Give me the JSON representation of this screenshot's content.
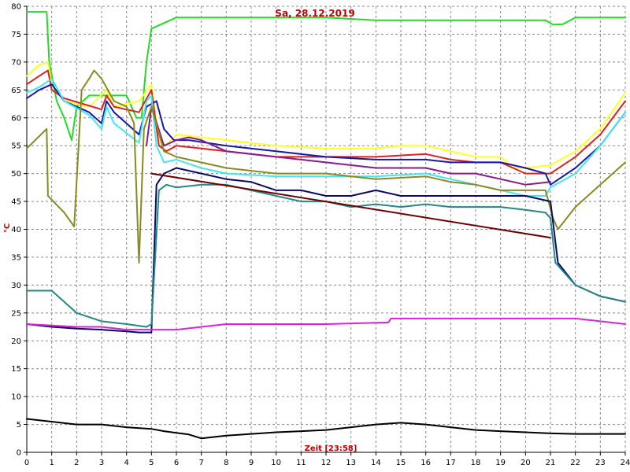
{
  "chart_data": {
    "type": "line",
    "title": "Sa, 28.12.2019",
    "xlabel": "Zeit [23:58]",
    "ylabel": "°C",
    "xlim": [
      0,
      24
    ],
    "ylim": [
      0,
      80
    ],
    "x_ticks": [
      0,
      1,
      2,
      3,
      4,
      5,
      6,
      7,
      8,
      9,
      10,
      11,
      12,
      13,
      14,
      15,
      16,
      17,
      18,
      19,
      20,
      21,
      22,
      23,
      24
    ],
    "y_ticks": [
      0,
      5,
      10,
      15,
      20,
      25,
      30,
      35,
      40,
      45,
      50,
      55,
      60,
      65,
      70,
      75,
      80
    ],
    "grid": true,
    "series": [
      {
        "color": "#22dd22",
        "points": [
          [
            0,
            79
          ],
          [
            0.8,
            79
          ],
          [
            0.9,
            70
          ],
          [
            1.2,
            63
          ],
          [
            1.5,
            60
          ],
          [
            1.8,
            56
          ],
          [
            2.0,
            62
          ],
          [
            2.5,
            64
          ],
          [
            3.0,
            64
          ],
          [
            3.5,
            64
          ],
          [
            4.0,
            64
          ],
          [
            4.4,
            60
          ],
          [
            4.6,
            60
          ],
          [
            4.8,
            70
          ],
          [
            5.0,
            76
          ],
          [
            5.5,
            77
          ],
          [
            6.0,
            78
          ],
          [
            8,
            78
          ],
          [
            10,
            78
          ],
          [
            12,
            78
          ],
          [
            14,
            77.5
          ],
          [
            16,
            77.5
          ],
          [
            18,
            77.5
          ],
          [
            20,
            77.5
          ],
          [
            20.8,
            77.5
          ],
          [
            21.1,
            76.7
          ],
          [
            21.5,
            76.8
          ],
          [
            22,
            78
          ],
          [
            24,
            78
          ]
        ]
      },
      {
        "color": "#ffff22",
        "points": [
          [
            0,
            67.5
          ],
          [
            0.5,
            69.5
          ],
          [
            0.85,
            70
          ],
          [
            1.0,
            66
          ],
          [
            1.5,
            63
          ],
          [
            2.5,
            62
          ],
          [
            3.2,
            65
          ],
          [
            3.5,
            62
          ],
          [
            4.5,
            63
          ],
          [
            5.0,
            66
          ],
          [
            5.3,
            56
          ],
          [
            5.6,
            55
          ],
          [
            6.0,
            57
          ],
          [
            8,
            56
          ],
          [
            10,
            55
          ],
          [
            12,
            54.5
          ],
          [
            14,
            54.5
          ],
          [
            15,
            55
          ],
          [
            16,
            55
          ],
          [
            17,
            54
          ],
          [
            18,
            53
          ],
          [
            19,
            53
          ],
          [
            19.5,
            51
          ],
          [
            20,
            51
          ],
          [
            21,
            51.5
          ],
          [
            22,
            54
          ],
          [
            23,
            58
          ],
          [
            24,
            64.5
          ]
        ]
      },
      {
        "color": "#dd2222",
        "points": [
          [
            0,
            66
          ],
          [
            0.5,
            67.5
          ],
          [
            0.85,
            68.5
          ],
          [
            1.0,
            65
          ],
          [
            1.5,
            63.5
          ],
          [
            3.0,
            61.5
          ],
          [
            3.2,
            64
          ],
          [
            3.5,
            62
          ],
          [
            4.5,
            61
          ],
          [
            5.0,
            65
          ],
          [
            5.3,
            55
          ],
          [
            5.6,
            54
          ],
          [
            6.0,
            55
          ],
          [
            8,
            54
          ],
          [
            10,
            53
          ],
          [
            12,
            53
          ],
          [
            14,
            53
          ],
          [
            16,
            53.5
          ],
          [
            17,
            52.5
          ],
          [
            18,
            52
          ],
          [
            19,
            52
          ],
          [
            20,
            50
          ],
          [
            21,
            50
          ],
          [
            22,
            53
          ],
          [
            23,
            57
          ],
          [
            24,
            63
          ]
        ]
      },
      {
        "color": "#1818aa",
        "points": [
          [
            0,
            63.5
          ],
          [
            0.5,
            65
          ],
          [
            1.0,
            66
          ],
          [
            1.5,
            63
          ],
          [
            2.5,
            61
          ],
          [
            3.0,
            59
          ],
          [
            3.2,
            63
          ],
          [
            3.5,
            61
          ],
          [
            4.5,
            57
          ],
          [
            4.8,
            62
          ],
          [
            5.2,
            63
          ],
          [
            5.5,
            58
          ],
          [
            5.9,
            56
          ],
          [
            6.5,
            56
          ],
          [
            8,
            55
          ],
          [
            10,
            54
          ],
          [
            12,
            53
          ],
          [
            14,
            52.5
          ],
          [
            16,
            52.5
          ],
          [
            17,
            52
          ],
          [
            18,
            52
          ],
          [
            19,
            52
          ],
          [
            20,
            51
          ],
          [
            20.8,
            50
          ],
          [
            21,
            48
          ],
          [
            22,
            51
          ],
          [
            23,
            55
          ],
          [
            24,
            61
          ]
        ]
      },
      {
        "color": "#44e6ee",
        "points": [
          [
            0,
            64.5
          ],
          [
            0.5,
            65.5
          ],
          [
            1.0,
            67
          ],
          [
            1.5,
            63
          ],
          [
            2.5,
            60.5
          ],
          [
            3.0,
            58
          ],
          [
            3.2,
            62
          ],
          [
            3.5,
            59
          ],
          [
            4.5,
            55.5
          ],
          [
            4.8,
            63
          ],
          [
            5.0,
            64
          ],
          [
            5.2,
            55
          ],
          [
            5.5,
            52
          ],
          [
            6.0,
            52.5
          ],
          [
            7,
            51
          ],
          [
            8,
            50
          ],
          [
            10,
            49.5
          ],
          [
            12,
            49.5
          ],
          [
            14,
            49.5
          ],
          [
            16,
            50
          ],
          [
            17,
            49
          ],
          [
            18,
            48
          ],
          [
            19,
            47
          ],
          [
            20,
            46
          ],
          [
            20.8,
            46
          ],
          [
            21,
            47.5
          ],
          [
            22,
            50
          ],
          [
            23,
            55
          ],
          [
            24,
            61
          ]
        ]
      },
      {
        "color": "#8a1a8a",
        "points": [
          [
            4.8,
            55
          ],
          [
            5.0,
            62
          ],
          [
            5.5,
            55
          ],
          [
            6.0,
            56
          ],
          [
            6.5,
            56.5
          ],
          [
            7,
            56
          ],
          [
            8,
            54
          ],
          [
            10,
            53
          ],
          [
            12,
            52
          ],
          [
            14,
            51
          ],
          [
            16,
            51
          ],
          [
            17,
            50
          ],
          [
            18,
            50
          ],
          [
            19,
            49
          ],
          [
            20,
            48
          ],
          [
            21,
            48.5
          ]
        ]
      },
      {
        "color": "#8a8a22",
        "points": [
          [
            0,
            54.5
          ],
          [
            0.8,
            58
          ],
          [
            0.85,
            46
          ],
          [
            1.5,
            43
          ],
          [
            1.9,
            40.5
          ],
          [
            2.2,
            65
          ],
          [
            2.5,
            67
          ],
          [
            2.7,
            68.5
          ],
          [
            3.0,
            67
          ],
          [
            3.5,
            63
          ],
          [
            4.0,
            62
          ],
          [
            4.3,
            59
          ],
          [
            4.5,
            34
          ],
          [
            4.7,
            58
          ],
          [
            5.0,
            62
          ],
          [
            5.5,
            54
          ],
          [
            6.0,
            53
          ],
          [
            8,
            51
          ],
          [
            10,
            50
          ],
          [
            12,
            50
          ],
          [
            14,
            49
          ],
          [
            16,
            49.5
          ],
          [
            17,
            48.5
          ],
          [
            18,
            48
          ],
          [
            19,
            47
          ],
          [
            20,
            47
          ],
          [
            20.8,
            47
          ],
          [
            21.1,
            42
          ],
          [
            21.3,
            40
          ],
          [
            22,
            44
          ],
          [
            23,
            48
          ],
          [
            24,
            52
          ]
        ]
      },
      {
        "color": "#0a0a66",
        "points": [
          [
            0,
            23
          ],
          [
            1,
            22.5
          ],
          [
            2,
            22.2
          ],
          [
            3,
            22
          ],
          [
            4,
            21.7
          ],
          [
            4.5,
            21.5
          ],
          [
            5.0,
            21.5
          ],
          [
            5.2,
            48
          ],
          [
            5.5,
            50
          ],
          [
            6.0,
            51
          ],
          [
            7,
            50
          ],
          [
            8,
            49
          ],
          [
            9,
            48.5
          ],
          [
            10,
            47
          ],
          [
            11,
            47
          ],
          [
            12,
            46
          ],
          [
            13,
            46
          ],
          [
            14,
            47
          ],
          [
            15,
            46
          ],
          [
            16,
            46
          ],
          [
            17,
            46
          ],
          [
            18,
            46
          ],
          [
            19,
            46
          ],
          [
            20,
            46
          ],
          [
            21,
            45
          ],
          [
            21.3,
            34
          ],
          [
            22,
            30
          ],
          [
            23,
            28
          ],
          [
            24,
            27
          ]
        ]
      },
      {
        "color": "#228888",
        "points": [
          [
            0,
            29
          ],
          [
            1,
            29
          ],
          [
            2,
            25
          ],
          [
            3,
            23.5
          ],
          [
            4,
            23
          ],
          [
            4.8,
            22.5
          ],
          [
            5.0,
            23
          ],
          [
            5.3,
            47
          ],
          [
            5.6,
            48
          ],
          [
            6,
            47.5
          ],
          [
            7,
            48
          ],
          [
            8,
            48
          ],
          [
            9,
            47
          ],
          [
            10,
            46
          ],
          [
            11,
            45
          ],
          [
            12,
            45
          ],
          [
            13,
            44
          ],
          [
            14,
            44.5
          ],
          [
            15,
            44
          ],
          [
            16,
            44.5
          ],
          [
            17,
            44
          ],
          [
            18,
            44
          ],
          [
            19,
            44
          ],
          [
            20,
            43.5
          ],
          [
            20.8,
            43
          ],
          [
            21,
            42
          ],
          [
            21.2,
            34
          ],
          [
            22,
            30
          ],
          [
            23,
            28
          ],
          [
            24,
            27
          ]
        ]
      },
      {
        "color": "#700000",
        "points": [
          [
            5.0,
            50
          ],
          [
            21,
            38.5
          ]
        ]
      },
      {
        "color": "#dd22dd",
        "points": [
          [
            0,
            23
          ],
          [
            2,
            22.5
          ],
          [
            3,
            22.5
          ],
          [
            4,
            22
          ],
          [
            5,
            22
          ],
          [
            6,
            22
          ],
          [
            7,
            22.5
          ],
          [
            8,
            23
          ],
          [
            10,
            23
          ],
          [
            12,
            23
          ],
          [
            14.5,
            23.3
          ],
          [
            14.6,
            24
          ],
          [
            17,
            24
          ],
          [
            20,
            24
          ],
          [
            21,
            24
          ],
          [
            22,
            24
          ],
          [
            23,
            23.5
          ],
          [
            24,
            23
          ]
        ]
      },
      {
        "color": "#000000",
        "points": [
          [
            0,
            6
          ],
          [
            1,
            5.5
          ],
          [
            2,
            5
          ],
          [
            3,
            5
          ],
          [
            4,
            4.5
          ],
          [
            5,
            4.2
          ],
          [
            5.5,
            3.8
          ],
          [
            6,
            3.5
          ],
          [
            6.5,
            3.2
          ],
          [
            7,
            2.5
          ],
          [
            8,
            3
          ],
          [
            9,
            3.3
          ],
          [
            10,
            3.6
          ],
          [
            11,
            3.8
          ],
          [
            12,
            4
          ],
          [
            13,
            4.5
          ],
          [
            14,
            5
          ],
          [
            15,
            5.3
          ],
          [
            16,
            5
          ],
          [
            17,
            4.5
          ],
          [
            18,
            4
          ],
          [
            19,
            3.8
          ],
          [
            20,
            3.6
          ],
          [
            21,
            3.4
          ],
          [
            22,
            3.3
          ],
          [
            23,
            3.3
          ],
          [
            24,
            3.3
          ]
        ]
      }
    ]
  }
}
